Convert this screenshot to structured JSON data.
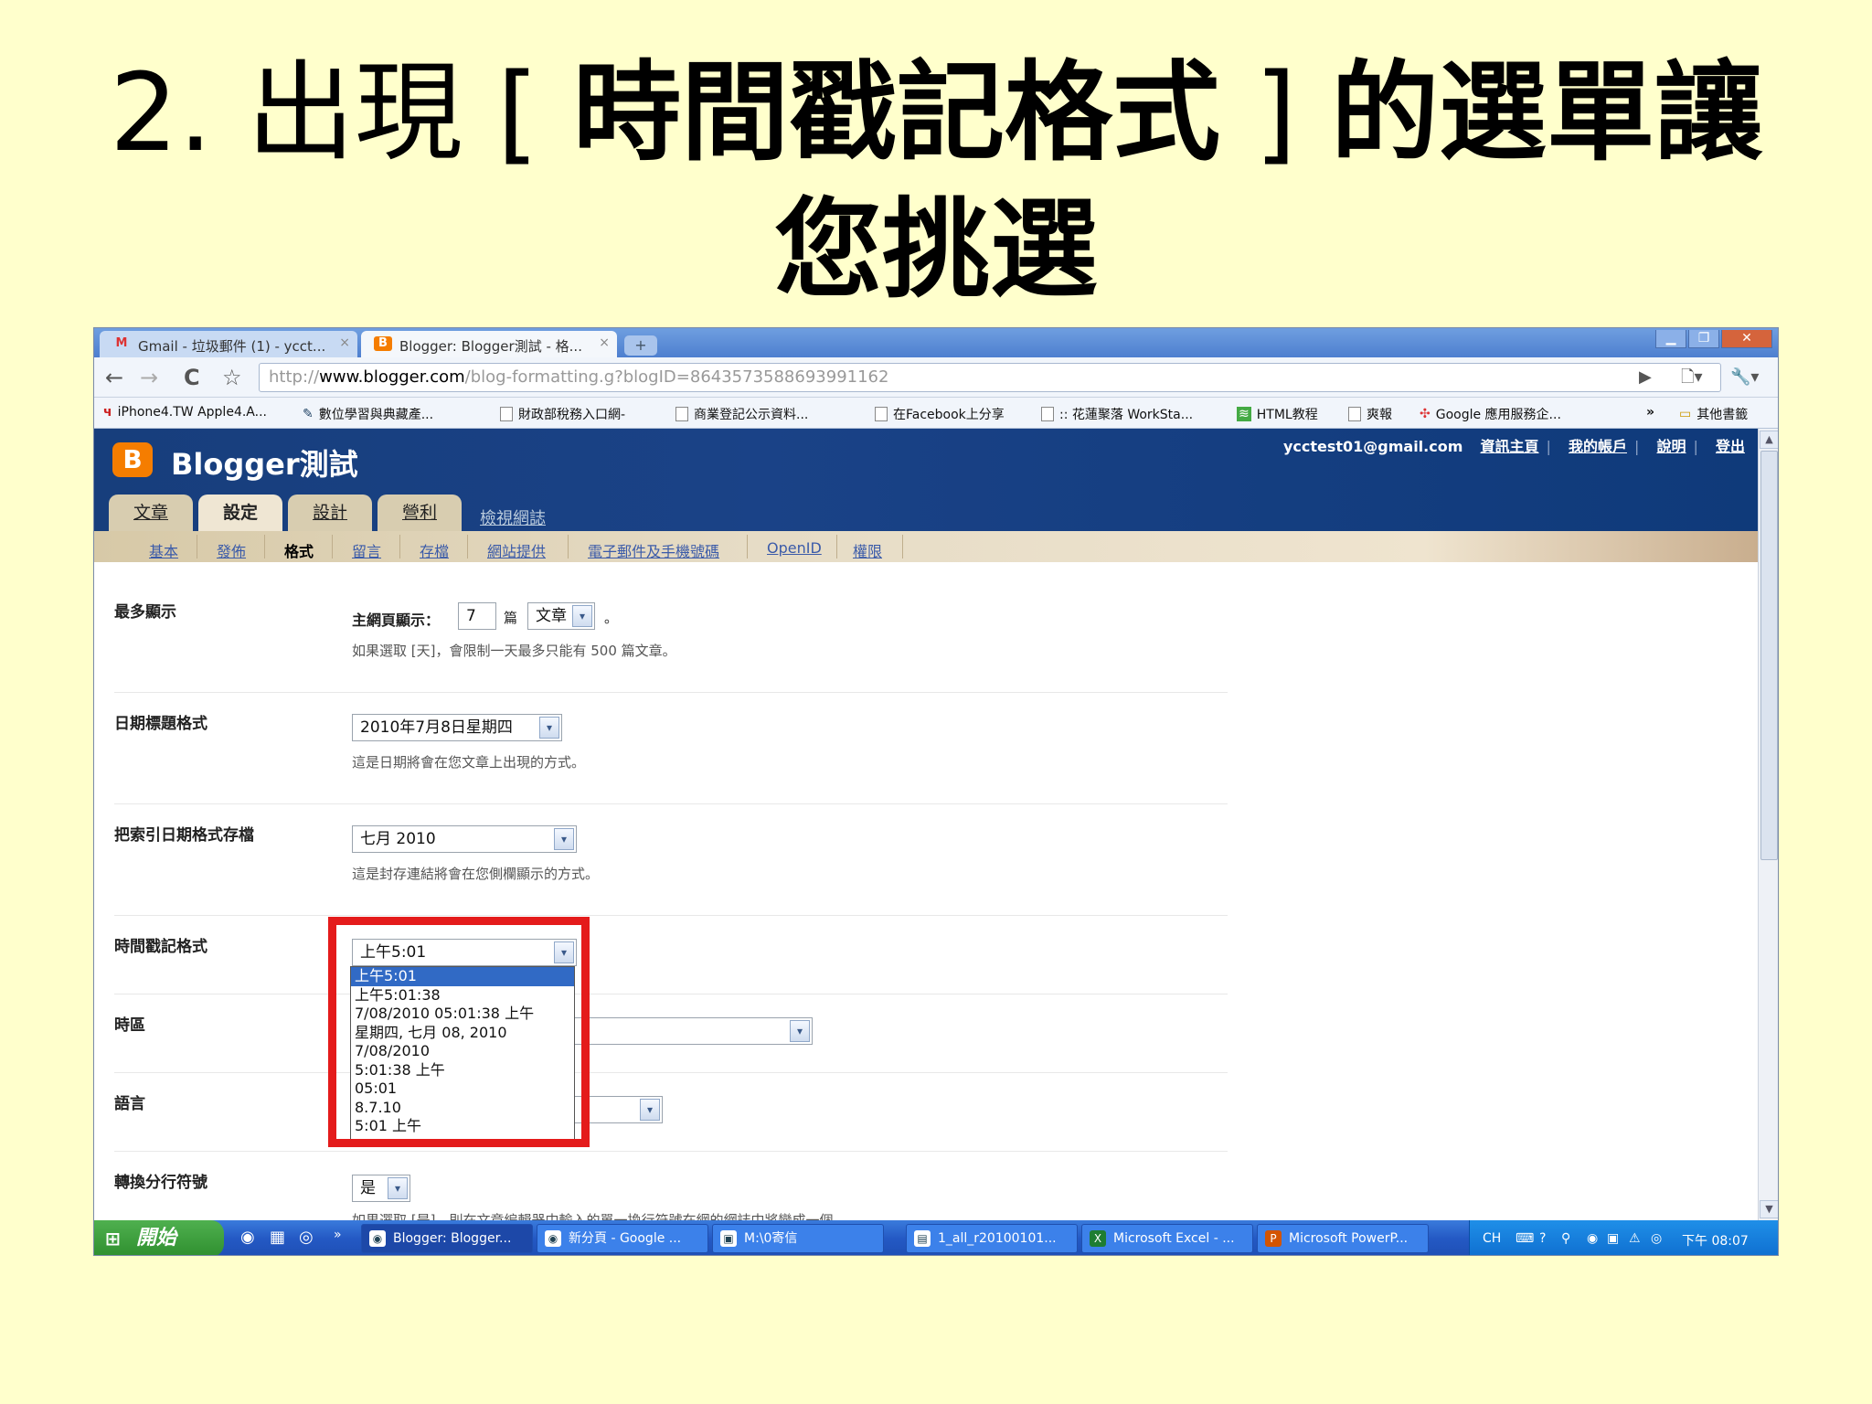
{
  "slide": {
    "title_prefix": "2. 出現 [ ",
    "title_em": "時間戳記格式",
    "title_suffix_plain": " ] ",
    "title_suffix_bold": "的選單讓",
    "title_line2": "您挑選"
  },
  "browser": {
    "tabs": [
      {
        "label": "Gmail - 垃圾郵件 (1) - ycct...",
        "icon": "gmail-icon",
        "close": "×"
      },
      {
        "label": "Blogger: Blogger測試 - 格...",
        "icon": "blogger-icon",
        "close": "×"
      }
    ],
    "new_tab": "+",
    "window_buttons": {
      "minimize": "▁",
      "restore": "❐",
      "close": "✕"
    },
    "nav": {
      "back": "←",
      "forward": "→",
      "reload": "C",
      "star": "☆"
    },
    "address": {
      "prefix": "http://",
      "domain": "www.blogger.com",
      "path": "/blog-formatting.g?blogID=8643573588693991162"
    },
    "toolbar_icons": {
      "go": "▶",
      "page": "🗋▾",
      "tools": "🔧▾"
    },
    "bookmarks": [
      {
        "label": "iPhone4.TW Apple4.A...",
        "icon": "ч"
      },
      {
        "label": "數位學習與典藏產...",
        "icon": "✎"
      },
      {
        "label": "財政部稅務入口網-",
        "icon": ""
      },
      {
        "label": "商業登記公示資料...",
        "icon": ""
      },
      {
        "label": "在Facebook上分享",
        "icon": ""
      },
      {
        "label": ":: 花蓮聚落 WorkSta...",
        "icon": ""
      },
      {
        "label": "HTML教程",
        "icon": "≋"
      },
      {
        "label": "爽報",
        "icon": ""
      },
      {
        "label": "Google 應用服務企...",
        "icon": "✣"
      }
    ],
    "bookmarks_more": "»",
    "other_bookmarks": "其他書籤"
  },
  "blogger": {
    "logo_letter": "B",
    "blog_title": "Blogger測試",
    "email": "ycctest01@gmail.com",
    "links": [
      "資訊主頁",
      "我的帳戶",
      "說明",
      "登出"
    ],
    "link_sep": "|",
    "main_tabs": [
      "文章",
      "設定",
      "設計",
      "營利"
    ],
    "view_blog": "檢視網誌",
    "sub_tabs": [
      "基本",
      "發佈",
      "格式",
      "留言",
      "存檔",
      "網站提供",
      "電子郵件及手機號碼",
      "OpenID",
      "權限"
    ]
  },
  "settings": {
    "max_show": {
      "label": "最多顯示",
      "prefix": "主網頁顯示：",
      "value": "7",
      "unit": "篇",
      "select": "文章",
      "suffix": "。",
      "note": "如果選取 [天]，會限制一天最多只能有 500 篇文章。"
    },
    "date_header": {
      "label": "日期標題格式",
      "value": "2010年7月8日星期四",
      "note": "這是日期將會在您文章上出現的方式。"
    },
    "archive_date": {
      "label": "把索引日期格式存檔",
      "value": "七月 2010",
      "note": "這是封存連結將會在您側欄顯示的方式。"
    },
    "timestamp": {
      "label": "時間戳記格式",
      "value": "上午5:01",
      "options": [
        "上午5:01",
        "上午5:01:38",
        "7/08/2010 05:01:38 上午",
        "星期四, 七月 08, 2010",
        "7/08/2010",
        "5:01:38 上午",
        "05:01",
        "8.7.10",
        "5:01 上午"
      ],
      "selected_index": 0
    },
    "timezone": {
      "label": "時區"
    },
    "language": {
      "label": "語言"
    },
    "line_breaks": {
      "label": "轉換分行符號",
      "value": "是",
      "note": "如果選取 [是]，則在文章編輯器中輸入的單一換行符號在網的網誌中將變成一個"
    },
    "dropdown_arrow": "▾"
  },
  "taskbar": {
    "start": "開始",
    "tasks": [
      {
        "label": "Blogger: Blogger...",
        "icon": "◉"
      },
      {
        "label": "新分頁 - Google ...",
        "icon": "◉"
      },
      {
        "label": "M:\\0寄信",
        "icon": "▣"
      },
      {
        "label": "1_all_r20100101...",
        "icon": "▤"
      },
      {
        "label": "Microsoft Excel - ...",
        "icon": "X"
      },
      {
        "label": "Microsoft PowerP...",
        "icon": "P"
      }
    ],
    "lang": "CH",
    "clock": "下午 08:07"
  },
  "colors": {
    "slide_bg": "#ffffcc",
    "blogger_orange": "#f57d00",
    "highlight_red": "#e41b1b",
    "selection_blue": "#316ac5"
  }
}
